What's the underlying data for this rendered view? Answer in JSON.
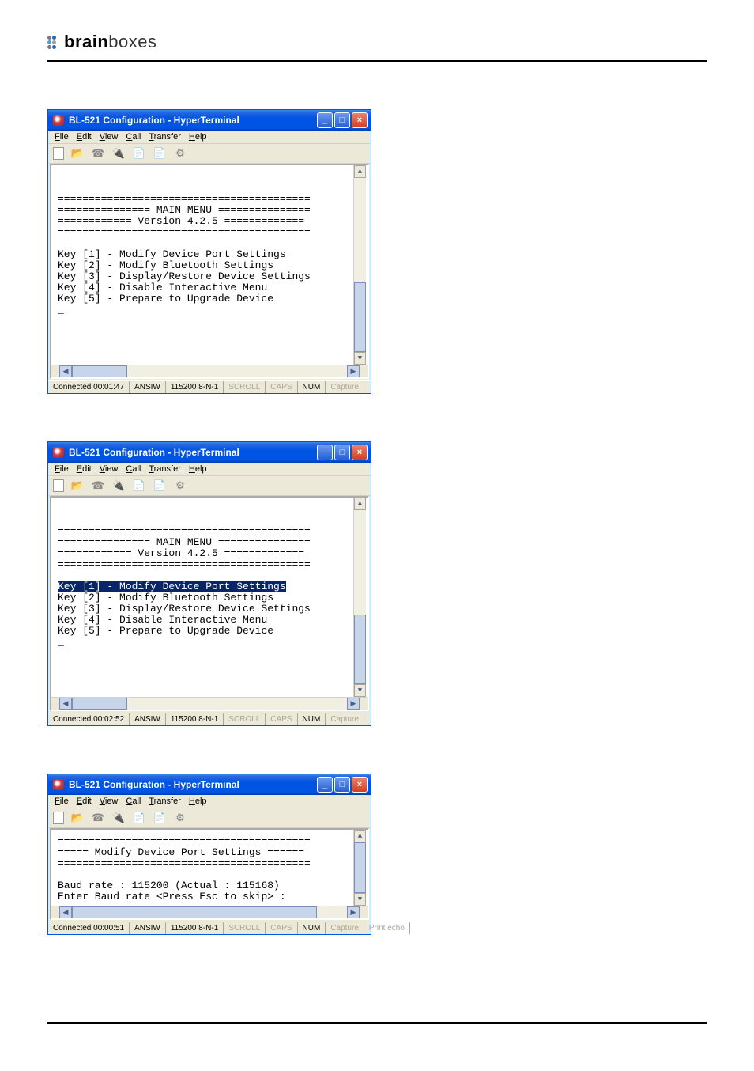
{
  "brand": {
    "bold": "brain",
    "light": "boxes"
  },
  "windows": [
    {
      "title": "BL-521 Configuration - HyperTerminal",
      "menubar": [
        "File",
        "Edit",
        "View",
        "Call",
        "Transfer",
        "Help"
      ],
      "toolbar_icons": [
        "new-icon",
        "open-icon",
        "call-icon",
        "disconnect-icon",
        "send-icon",
        "receive-icon",
        "properties-icon"
      ],
      "terminal_lines": [
        "",
        "",
        "=========================================",
        "=============== MAIN MENU ===============",
        "============ Version 4.2.5 =============",
        "=========================================",
        "",
        "Key [1] - Modify Device Port Settings",
        "Key [2] - Modify Bluetooth Settings",
        "Key [3] - Display/Restore Device Settings",
        "Key [4] - Disable Interactive Menu",
        "Key [5] - Prepare to Upgrade Device",
        "_"
      ],
      "highlight_line": -1,
      "status": {
        "conn": "Connected 00:01:47",
        "emul": "ANSIW",
        "cfg": "115200 8-N-1",
        "scroll": "SCROLL",
        "caps": "CAPS",
        "num": "NUM",
        "capture": "Capture"
      },
      "short": false,
      "hthumb_wide": false
    },
    {
      "title": "BL-521 Configuration - HyperTerminal",
      "menubar": [
        "File",
        "Edit",
        "View",
        "Call",
        "Transfer",
        "Help"
      ],
      "toolbar_icons": [
        "new-icon",
        "open-icon",
        "call-icon",
        "disconnect-icon",
        "send-icon",
        "receive-icon",
        "properties-icon"
      ],
      "terminal_lines": [
        "",
        "",
        "=========================================",
        "=============== MAIN MENU ===============",
        "============ Version 4.2.5 =============",
        "=========================================",
        "",
        "Key [1] - Modify Device Port Settings",
        "Key [2] - Modify Bluetooth Settings",
        "Key [3] - Display/Restore Device Settings",
        "Key [4] - Disable Interactive Menu",
        "Key [5] - Prepare to Upgrade Device",
        "_"
      ],
      "highlight_line": 7,
      "status": {
        "conn": "Connected 00:02:52",
        "emul": "ANSIW",
        "cfg": "115200 8-N-1",
        "scroll": "SCROLL",
        "caps": "CAPS",
        "num": "NUM",
        "capture": "Capture"
      },
      "short": false,
      "hthumb_wide": false
    },
    {
      "title": "BL-521 Configuration - HyperTerminal",
      "menubar": [
        "File",
        "Edit",
        "View",
        "Call",
        "Transfer",
        "Help"
      ],
      "toolbar_icons": [
        "new-icon",
        "open-icon",
        "call-icon",
        "disconnect-icon",
        "send-icon",
        "receive-icon",
        "properties-icon"
      ],
      "terminal_lines": [
        "=========================================",
        "===== Modify Device Port Settings ======",
        "=========================================",
        "",
        "Baud rate : 115200 (Actual : 115168)",
        "Enter Baud rate <Press Esc to skip> :"
      ],
      "highlight_line": -1,
      "status": {
        "conn": "Connected 00:00:51",
        "emul": "ANSIW",
        "cfg": "115200 8-N-1",
        "scroll": "SCROLL",
        "caps": "CAPS",
        "num": "NUM",
        "capture": "Capture",
        "print": "Print echo"
      },
      "short": true,
      "hthumb_wide": true
    }
  ]
}
